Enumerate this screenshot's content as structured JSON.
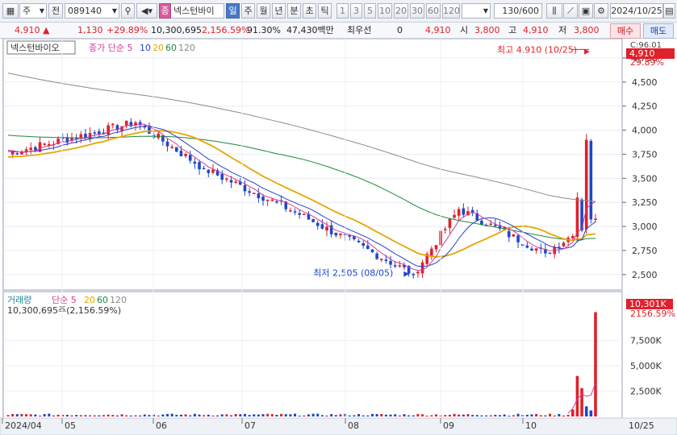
{
  "toolbar": {
    "market_label": "주",
    "view_label": "전",
    "stock_code": "089140",
    "stock_name_badge": "종",
    "stock_name": "넥스턴바이",
    "periods": [
      {
        "label": "일",
        "selected": true
      },
      {
        "label": "주",
        "selected": false
      },
      {
        "label": "월",
        "selected": false
      },
      {
        "label": "년",
        "selected": false
      },
      {
        "label": "분",
        "selected": false
      },
      {
        "label": "초",
        "selected": false
      },
      {
        "label": "틱",
        "selected": false
      }
    ],
    "intervals": [
      "1",
      "3",
      "5",
      "10",
      "20",
      "30",
      "60",
      "120"
    ],
    "count": "130",
    "count_total": "/600",
    "date": "2024/10/25"
  },
  "quote": {
    "price": "4,910",
    "change": "1,130",
    "change_pct": "+29.89%",
    "volume": "10,300,695",
    "volume_pct": "2,156.59%",
    "turnover_pct": "91.30%",
    "amount": "47,430백만",
    "best_quote_label": "최우선",
    "best_quote_value": "0",
    "current": "4,910",
    "open_label": "시",
    "open": "3,800",
    "high_label": "고",
    "high": "4,910",
    "low_label": "저",
    "low": "3,800",
    "buy_label": "매수",
    "sell_label": "매도"
  },
  "colors": {
    "up": "#e0202a",
    "down": "#1c48c8",
    "ma5": "#d23c96",
    "ma10": "#2a3fc6",
    "ma20": "#e8a500",
    "ma60": "#1a8a3c",
    "ma120": "#8a8a8a"
  },
  "chart_data": [
    {
      "type": "candlestick",
      "title": "넥스턴바이오",
      "legend": [
        {
          "name": "종가 단순",
          "period": "5",
          "color": "#d23c96"
        },
        {
          "period": "10",
          "color": "#2a3fc6"
        },
        {
          "period": "20",
          "color": "#e8a500"
        },
        {
          "period": "60",
          "color": "#1a8a3c"
        },
        {
          "period": "120",
          "color": "#8a8a8a"
        }
      ],
      "y_ticks": [
        "4,750",
        "4,500",
        "4,250",
        "4,000",
        "3,750",
        "3,500",
        "3,250",
        "3,000",
        "2,750",
        "2,500"
      ],
      "ylim": [
        2390,
        4900
      ],
      "last_price_tag": "4,910",
      "last_pct_tag": "29.89%",
      "top_tag": "C:96.01",
      "high_annotation": "최고 4,910 (10/25)",
      "low_annotation": "최저 2,505 (08/05)",
      "key_closes": [
        {
          "date": "04/25",
          "close": 3760
        },
        {
          "date": "05/10",
          "close": 4080
        },
        {
          "date": "06/01",
          "close": 3600
        },
        {
          "date": "07/01",
          "close": 3150
        },
        {
          "date": "08/05",
          "close": 2505
        },
        {
          "date": "08/20",
          "close": 3180
        },
        {
          "date": "09/15",
          "close": 2720
        },
        {
          "date": "10/10",
          "close": 3080
        },
        {
          "date": "10/22",
          "close": 4750
        },
        {
          "date": "10/24",
          "close": 3780
        },
        {
          "date": "10/25",
          "close": 4910
        }
      ]
    },
    {
      "type": "bar",
      "title": "거래량",
      "legend": [
        {
          "name": "단순",
          "period": "5",
          "color": "#d23c96"
        },
        {
          "period": "20",
          "color": "#e8a500"
        },
        {
          "period": "60",
          "color": "#1a8a3c"
        },
        {
          "period": "120",
          "color": "#8a8a8a"
        }
      ],
      "info": "10,300,695주(2,156.59%)",
      "y_ticks": [
        "7,500K",
        "5,000K",
        "2,500K"
      ],
      "last_tag": "10,301K",
      "last_pct": "2156.59%",
      "key_volumes": [
        {
          "date": "10/21",
          "volume": 4000
        },
        {
          "date": "10/22",
          "volume": 2800
        },
        {
          "date": "10/24",
          "volume": 1000
        },
        {
          "date": "10/25",
          "volume": 10301
        }
      ]
    }
  ],
  "x_axis": [
    "2024/04",
    "05",
    "06",
    "07",
    "08",
    "09",
    "10",
    "10/25"
  ]
}
